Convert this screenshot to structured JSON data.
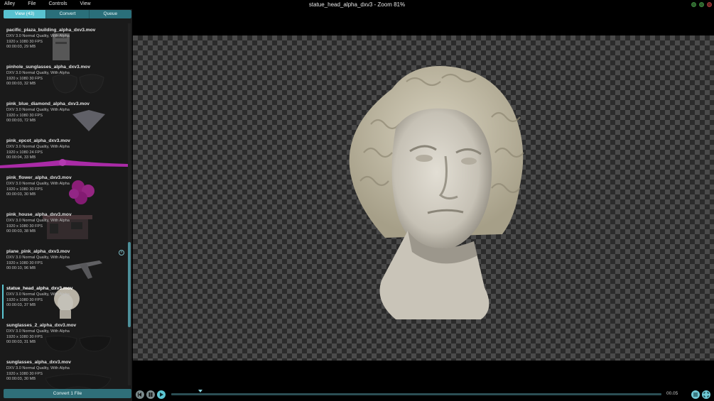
{
  "menu": [
    "Alley",
    "File",
    "Controls",
    "View"
  ],
  "window_title": "statue_head_alpha_dxv3 - Zoom 81%",
  "tabs": [
    {
      "label": "View (43)",
      "active": true
    },
    {
      "label": "Convert",
      "active": false
    },
    {
      "label": "Queue",
      "active": false
    }
  ],
  "files": [
    {
      "name": "pacific_plaza_building_alpha_dxv3.mov",
      "codec": "DXV 3.0 Normal Quality, With Alpha",
      "resolution": "1920 x 1080 30 FPS",
      "meta": "00:00:03, 29 MB",
      "selected": false
    },
    {
      "name": "pinhole_sunglasses_alpha_dxv3.mov",
      "codec": "DXV 3.0 Normal Quality, With Alpha",
      "resolution": "1920 x 1080 30 FPS",
      "meta": "00:00:03, 32 MB",
      "selected": false
    },
    {
      "name": "pink_blue_diamond_alpha_dxv3.mov",
      "codec": "DXV 3.0 Normal Quality, With Alpha",
      "resolution": "1920 x 1080 30 FPS",
      "meta": "00:00:03, 72 MB",
      "selected": false
    },
    {
      "name": "pink_epcot_alpha_dxv3.mov",
      "codec": "DXV 3.0 Normal Quality, With Alpha",
      "resolution": "1920 x 1080 24 FPS",
      "meta": "00:00:04, 33 MB",
      "selected": false
    },
    {
      "name": "pink_flower_alpha_dxv3.mov",
      "codec": "DXV 3.0 Normal Quality, With Alpha",
      "resolution": "1920 x 1080 30 FPS",
      "meta": "00:00:03, 30 MB",
      "selected": false
    },
    {
      "name": "pink_house_alpha_dxv3.mov",
      "codec": "DXV 3.0 Normal Quality, With Alpha",
      "resolution": "1920 x 1080 30 FPS",
      "meta": "00:00:03, 38 MB",
      "selected": false
    },
    {
      "name": "plane_pink_alpha_dxv3.mov",
      "codec": "DXV 3.0 Normal Quality, With Alpha",
      "resolution": "1920 x 1080 30 FPS",
      "meta": "00:00:10, 96 MB",
      "selected": false
    },
    {
      "name": "statue_head_alpha_dxv3.mov",
      "codec": "DXV 3.0 Normal Quality, With Alpha",
      "resolution": "1920 x 1080 30 FPS",
      "meta": "00:00:03, 37 MB",
      "selected": true
    },
    {
      "name": "sunglasses_2_alpha_dxv3.mov",
      "codec": "DXV 3.0 Normal Quality, With Alpha",
      "resolution": "1920 x 1080 30 FPS",
      "meta": "00:00:03, 31 MB",
      "selected": false
    },
    {
      "name": "sunglasses_alpha_dxv3.mov",
      "codec": "DXV 3.0 Normal Quality, With Alpha",
      "resolution": "1920 x 1080 30 FPS",
      "meta": "00:00:03, 30 MB",
      "selected": false
    }
  ],
  "convert_button": "Convert 1 File",
  "time_display": "00.05",
  "playback_progress": 0.06,
  "colors": {
    "accent": "#5cc6d3",
    "tab_bg": "#2a6f7a",
    "sidebar_bg": "#1a1a1a"
  }
}
